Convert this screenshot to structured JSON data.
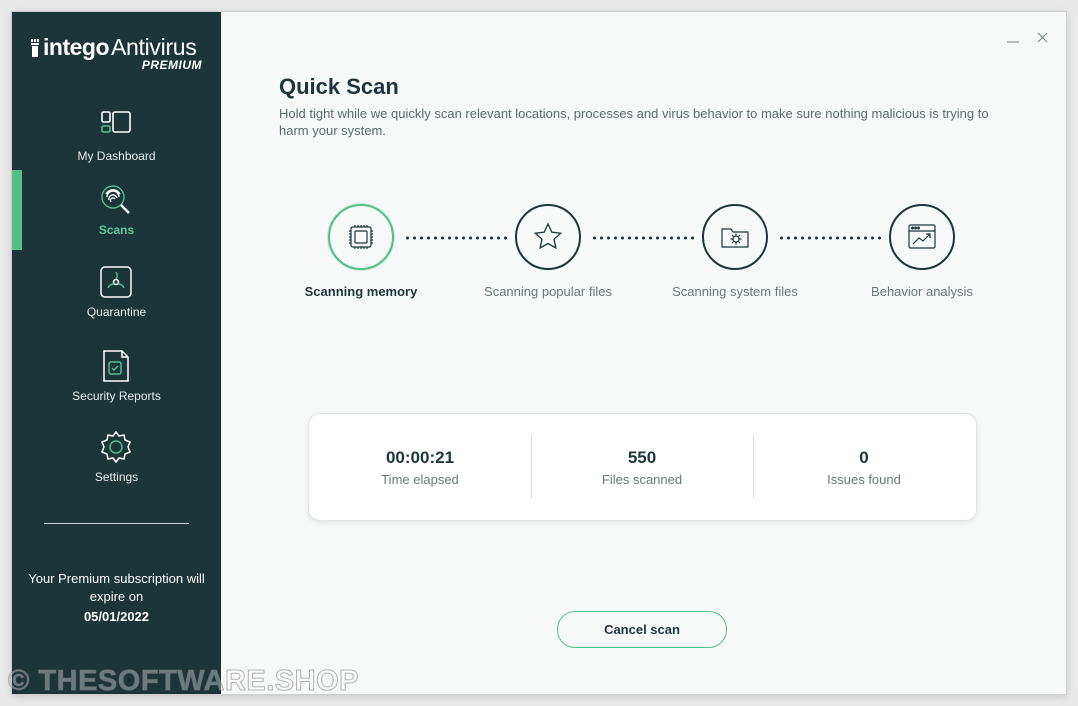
{
  "app": {
    "brand": "intego",
    "product": "Antivirus",
    "tier": "PREMIUM"
  },
  "sidebar": {
    "items": [
      {
        "label": "My Dashboard",
        "icon": "dashboard-icon"
      },
      {
        "label": "Scans",
        "icon": "fingerprint-search-icon",
        "active": true
      },
      {
        "label": "Quarantine",
        "icon": "biohazard-icon"
      },
      {
        "label": "Security Reports",
        "icon": "report-icon"
      },
      {
        "label": "Settings",
        "icon": "gear-icon"
      }
    ],
    "subscription_text": "Your Premium subscription will expire on",
    "subscription_date": "05/01/2022"
  },
  "window_controls": {
    "minimize": "–",
    "close": "×"
  },
  "main": {
    "title": "Quick Scan",
    "description": "Hold tight while we quickly scan relevant locations, processes and virus behavior to make sure nothing malicious is trying to harm your system.",
    "steps": [
      {
        "label": "Scanning memory",
        "icon": "memory-chip-icon",
        "active": true
      },
      {
        "label": "Scanning popular files",
        "icon": "star-icon",
        "active": false
      },
      {
        "label": "Scanning system files",
        "icon": "system-folder-icon",
        "active": false
      },
      {
        "label": "Behavior analysis",
        "icon": "behavior-chart-icon",
        "active": false
      }
    ],
    "stats": [
      {
        "value": "00:00:21",
        "label": "Time elapsed"
      },
      {
        "value": "550",
        "label": "Files scanned"
      },
      {
        "value": "0",
        "label": "Issues found"
      }
    ],
    "cancel_label": "Cancel scan"
  },
  "watermark": "© THESOFTWARE.SHOP",
  "colors": {
    "sidebar_bg": "#1b3538",
    "accent": "#53c08b",
    "text_dark": "#1d3639",
    "content_bg": "#f7f8f8"
  }
}
